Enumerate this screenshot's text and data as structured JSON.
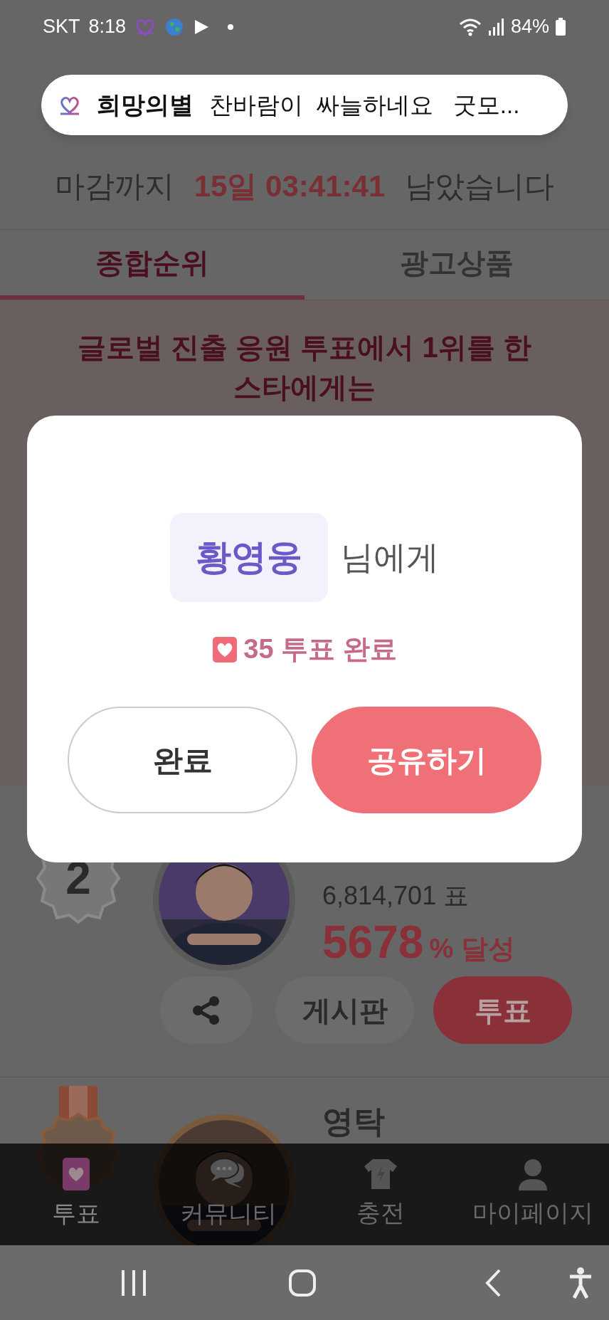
{
  "status_bar": {
    "carrier": "SKT",
    "time": "8:18",
    "battery": "84%"
  },
  "notification": {
    "app": "희망의별",
    "message": "찬바람이  싸늘하네요   굿모..."
  },
  "countdown": {
    "prefix": "마감까지",
    "remaining": "15일 03:41:41",
    "suffix": "남았습니다"
  },
  "tabs": [
    {
      "label": "종합순위",
      "selected": true
    },
    {
      "label": "광고상품",
      "selected": false
    }
  ],
  "banner": "글로벌 진출 응원 투표에서 1위를 한 스타에게는",
  "rankings": [
    {
      "kind": "silver",
      "rank": "2",
      "votes": "6,814,701 표",
      "percent": "5678",
      "percent_suffix": "% 달성",
      "board_button": "게시판",
      "vote_button": "투표"
    },
    {
      "kind": "bronze",
      "name": "영탁"
    }
  ],
  "dialog": {
    "recipient": "황영웅",
    "recipient_suffix": "님에게",
    "result": "35 투표 완료",
    "buttons": [
      {
        "label": "완료",
        "kind": "secondary"
      },
      {
        "label": "공유하기",
        "kind": "primary"
      }
    ]
  },
  "bottom_nav": [
    {
      "label": "투표",
      "selected": true
    },
    {
      "label": "커뮤니티",
      "selected": false
    },
    {
      "label": "충전",
      "selected": false
    },
    {
      "label": "마이페이지",
      "selected": false
    }
  ]
}
